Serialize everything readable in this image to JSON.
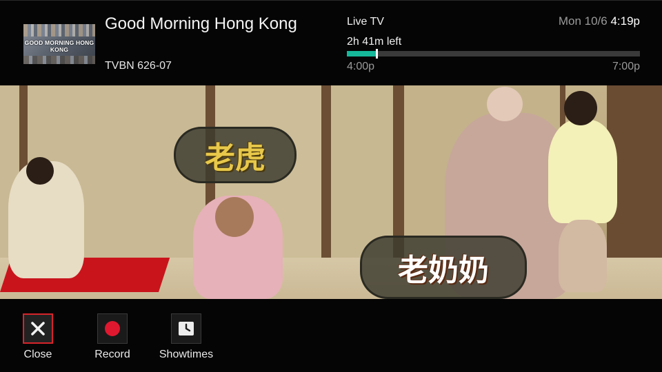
{
  "program": {
    "thumbnail_text": "GOOD MORNING HONG KONG",
    "title": "Good Morning Hong Kong",
    "channel": "TVBN 626-07"
  },
  "status": {
    "live_label": "Live TV",
    "time_left": "2h 41m left",
    "start_time": "4:00p",
    "end_time": "7:00p",
    "progress_fraction": 0.1,
    "progress_color": "#16b89a"
  },
  "clock": {
    "date": "Mon 10/6",
    "time": "4:19p"
  },
  "video": {
    "caption_1": "老虎",
    "caption_2": "老奶奶"
  },
  "controls": [
    {
      "label": "Close",
      "icon": "close-icon",
      "selected": true
    },
    {
      "label": "Record",
      "icon": "record-icon",
      "selected": false
    },
    {
      "label": "Showtimes",
      "icon": "clock-icon",
      "selected": false
    }
  ],
  "colors": {
    "accent_selected_border": "#d8242a",
    "record_red": "#e0182f"
  }
}
